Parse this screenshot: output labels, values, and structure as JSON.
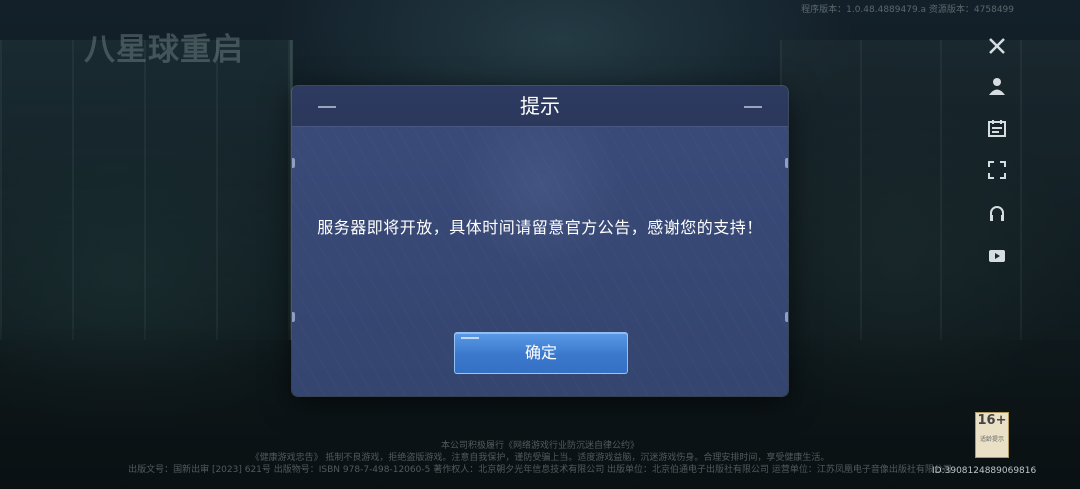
{
  "game": {
    "logo_text": "八星球重启",
    "version_text": "程序版本：1.0.48.4889479.a  资源版本：4758499"
  },
  "side_icons": [
    "tools-icon",
    "user-icon",
    "calendar-icon",
    "scan-icon",
    "headset-icon",
    "video-icon"
  ],
  "dialog": {
    "title": "提示",
    "message": "服务器即将开放，具体时间请留意官方公告，感谢您的支持！",
    "confirm_label": "确定"
  },
  "footer": {
    "line1": "本公司积极履行《网络游戏行业防沉迷自律公约》",
    "line2": "《健康游戏忠告》 抵制不良游戏，拒绝盗版游戏。注意自我保护，谨防受骗上当。适度游戏益脑，沉迷游戏伤身。合理安排时间，享受健康生活。",
    "line3": "出版文号：国新出审 [2023] 621号 出版物号：ISBN 978-7-498-12060-5 著作权人：北京朝夕光年信息技术有限公司 出版单位：北京伯通电子出版社有限公司  运营单位：江苏凤凰电子音像出版社有限公司",
    "rating_label": "16+",
    "rating_sub": "适龄提示",
    "id_text": "ID:3908124889069816"
  }
}
